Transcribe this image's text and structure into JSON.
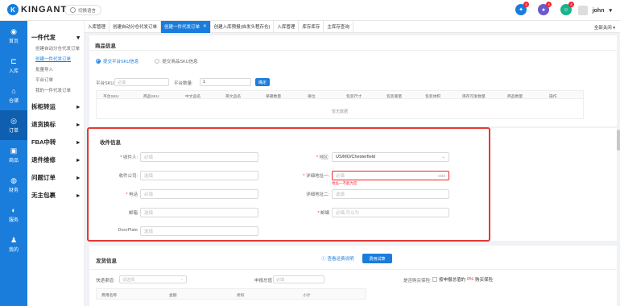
{
  "header": {
    "logo_mark": "K",
    "logo_text": "KINGANT",
    "lang_label": "切换语言",
    "badges": [
      "4",
      "4",
      "4"
    ],
    "user": "john",
    "colors": {
      "brand": "#1a7ddc",
      "badge": "#f5222d",
      "red_box": "#e53935"
    }
  },
  "sidebar": {
    "items": [
      {
        "label": "首页",
        "icon": "palette-icon"
      },
      {
        "label": "入库",
        "icon": "inbound-icon"
      },
      {
        "label": "仓储",
        "icon": "warehouse-icon"
      },
      {
        "label": "订单",
        "icon": "order-icon"
      },
      {
        "label": "商品",
        "icon": "goods-icon"
      },
      {
        "label": "财务",
        "icon": "finance-icon"
      },
      {
        "label": "服务",
        "icon": "service-icon"
      },
      {
        "label": "我的",
        "icon": "user-icon"
      }
    ]
  },
  "menu": {
    "group1": "一件代发",
    "subs": [
      "创建自动分仓代发订单",
      "创建一件代发订单",
      "批量导入",
      "平台订单",
      "我的一件代发订单"
    ],
    "groups": [
      "拆柜转运",
      "退货换标",
      "FBA中转",
      "退件维修",
      "问题订单",
      "无主包裹"
    ]
  },
  "tabs": {
    "items": [
      "入库管理",
      "创建自动分仓代发订单",
      "创建一件代发订单",
      "创建入库预报(自发头程存仓)",
      "入库管理",
      "库存库存",
      "主库存查询"
    ],
    "close_all": "全部关闭"
  },
  "goods": {
    "title": "商品信息",
    "radio1": "提交平台SKU信息",
    "radio2": "提交商品SKU信息",
    "platform_sku_label": "平台SKU",
    "platform_sku_placeholder": "必填",
    "qty_label": "平台数量:",
    "qty_value": "1",
    "confirm": "确定",
    "columns": [
      "平台SKU",
      "商品SKU",
      "中文品名",
      "英文品名",
      "单箱数量",
      "单位",
      "包装尺寸",
      "包装重量",
      "包装体积",
      "库存可发数量",
      "商品数量",
      "操作"
    ],
    "empty": "暂无数据"
  },
  "recipient": {
    "title": "收件信息",
    "fields": {
      "name_label": "收件人:",
      "name_ph": "必填",
      "company_label": "收件公司:",
      "company_ph": "选填",
      "phone_label": "电话",
      "phone_ph": "必填",
      "email_label": "邮箱",
      "email_ph": "选填",
      "doorplate_label": "DoorPlate",
      "doorplate_ph": "选填",
      "region_label": "地区:",
      "region_value": "US/MO/Chesterfield",
      "addr1_label": "详细地址一:",
      "addr1_ph": "必填",
      "addr1_count": "0/40",
      "addr1_error": "地址一不能为空",
      "addr2_label": "详细地址二:",
      "addr2_ph": "选填",
      "zip_label": "邮编",
      "zip_ph": "必填,可以为"
    }
  },
  "shipping": {
    "title": "发货信息",
    "fee_link": "查看运费说明",
    "fee_button": "费用试算",
    "express_label": "快递渠道:",
    "express_ph": "请选择",
    "declare_label": "申报总值",
    "declare_ph": "必填",
    "insure_label": "是否购买保险:",
    "insure_prefix": "按申报总值的",
    "insure_pct": "0%",
    "insure_suffix": "购买保险",
    "cols": [
      "费用名称",
      "金额",
      "折扣",
      "小计"
    ]
  }
}
